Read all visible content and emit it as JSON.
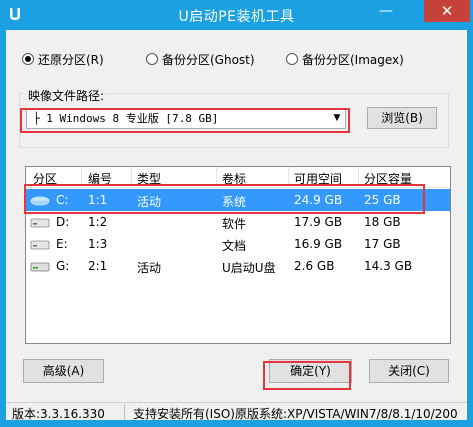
{
  "window": {
    "title": "U启动PE装机工具",
    "minimize_glyph": "—",
    "close_glyph": "✕",
    "icon": "u-logo-icon",
    "accent_color": "#1ba1e2",
    "close_color": "#c7413b"
  },
  "mode": {
    "options": [
      {
        "label": "还原分区(R)",
        "checked": true
      },
      {
        "label": "备份分区(Ghost)",
        "checked": false
      },
      {
        "label": "备份分区(Imagex)",
        "checked": false
      }
    ]
  },
  "image_path": {
    "label": "映像文件路径:",
    "selected_value": "├ 1 Windows 8 专业版 [7.8 GB]",
    "browse_label": "浏览(B)"
  },
  "partitions": {
    "columns": [
      "分区",
      "编号",
      "类型",
      "卷标",
      "可用空间",
      "分区容量"
    ],
    "rows": [
      {
        "drive": "C:",
        "number": "1:1",
        "type": "活动",
        "label": "系统",
        "free": "24.9 GB",
        "size": "25 GB",
        "selected": true,
        "icon": "system-drive-icon"
      },
      {
        "drive": "D:",
        "number": "1:2",
        "type": "",
        "label": "软件",
        "free": "17.9 GB",
        "size": "18 GB",
        "selected": false,
        "icon": "hard-drive-icon"
      },
      {
        "drive": "E:",
        "number": "1:3",
        "type": "",
        "label": "文档",
        "free": "16.9 GB",
        "size": "17 GB",
        "selected": false,
        "icon": "hard-drive-icon"
      },
      {
        "drive": "G:",
        "number": "2:1",
        "type": "活动",
        "label": "U启动U盘",
        "free": "2.6 GB",
        "size": "14.3 GB",
        "selected": false,
        "icon": "usb-drive-icon"
      }
    ]
  },
  "buttons": {
    "advanced": "高级(A)",
    "ok": "确定(Y)",
    "close": "关闭(C)"
  },
  "status": {
    "version": "版本:3.3.16.330",
    "support": "支持安装所有(ISO)原版系统:XP/VISTA/WIN7/8/8.1/10/200"
  },
  "highlight_color": "#e8343c",
  "selection_color": "#3399ff"
}
